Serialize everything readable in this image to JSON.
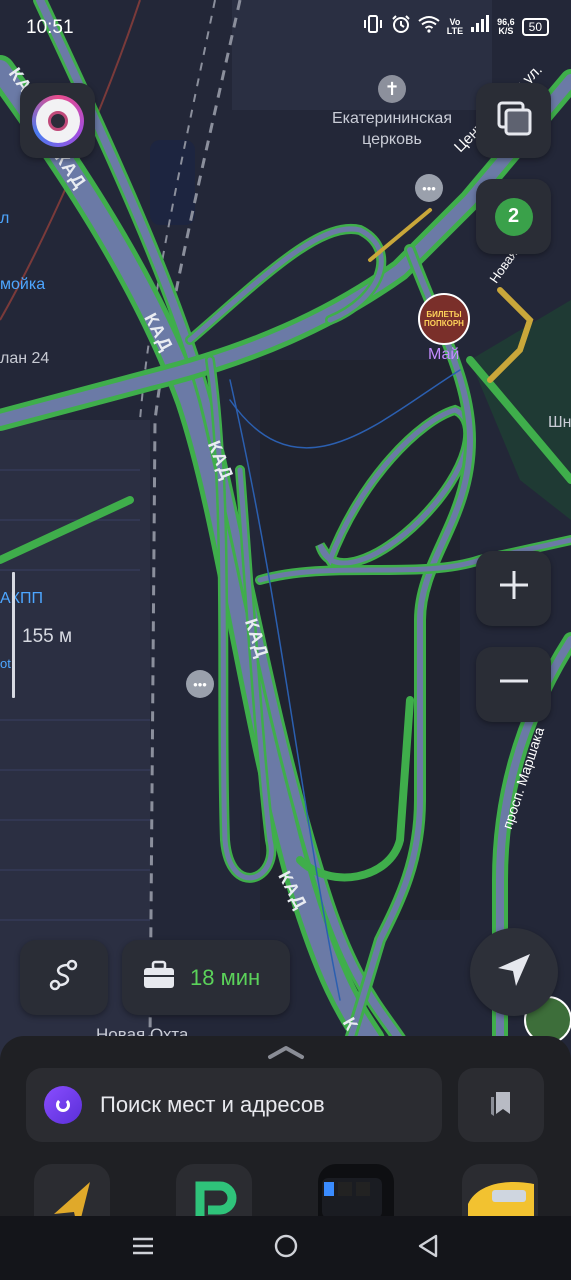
{
  "status_bar": {
    "time": "10:51",
    "volte_top": "Vo",
    "volte_bottom": "LTE",
    "speed_value": "96,6",
    "speed_unit": "K/S",
    "battery": "50"
  },
  "map": {
    "poi_church": "Екатерининская\nцерковь",
    "road_kad_1": "КАД",
    "road_kad_2": "КАД",
    "road_kad_3": "КАД",
    "road_kad_4": "КАД",
    "road_kad_5": "КАД",
    "road_kad_6": "К",
    "street_central": "Центральная ул.",
    "street_novaya": "Новая ул.",
    "street_marshaka": "просп. Маршака",
    "label_mai": "Май",
    "label_left_1": "л",
    "label_left_2": "мойка",
    "label_left_3": "лан 24",
    "label_akpp": "АКПП",
    "label_ot": "ot",
    "label_shn": "Шн",
    "label_okhta": "Новая Охта",
    "scale": "155 м",
    "mai_ad_top": "БИЛЕТЫ",
    "mai_ad_bottom": "ПОПКОРН"
  },
  "controls": {
    "commute_time": "18 мин",
    "icons": [
      "avatar-icon",
      "layers-icon",
      "traffic-icon",
      "plus-icon",
      "minus-icon",
      "route-icon",
      "briefcase-icon",
      "navigation-arrow-icon",
      "chevron-up-icon",
      "alice-icon",
      "bookmarks-icon"
    ]
  },
  "traffic_level": "2",
  "search": {
    "placeholder": "Поиск мест и адресов"
  },
  "nav_bar": {
    "icons": [
      "menu-icon",
      "home-icon",
      "back-icon"
    ]
  },
  "colors": {
    "traffic_green": "#3fae4b",
    "road_fill": "#6f7fae",
    "accent_green": "#5bd25a",
    "alice_purple": "#7a45f0"
  }
}
